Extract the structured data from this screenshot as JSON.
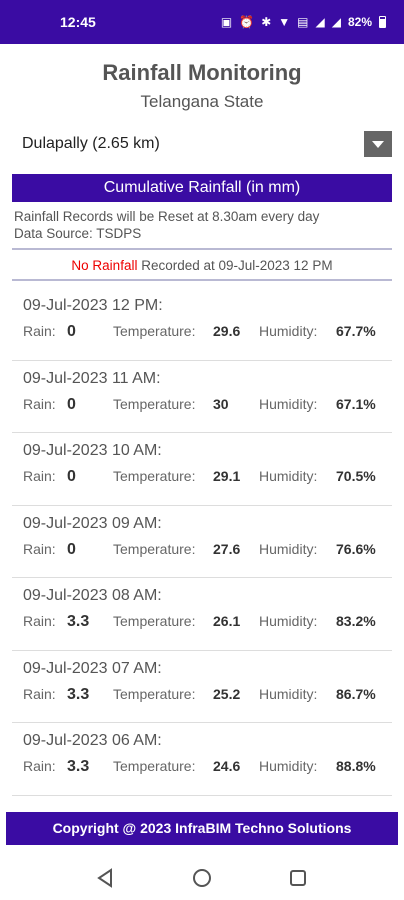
{
  "status_bar": {
    "time": "12:45",
    "battery": "82%"
  },
  "header": {
    "title": "Rainfall Monitoring",
    "subtitle": "Telangana State"
  },
  "station": {
    "selected": "Dulapally (2.65 km)"
  },
  "cumulative_label": "Cumulative Rainfall (in mm)",
  "notes": {
    "reset": "Rainfall Records will be Reset at 8.30am every day",
    "source": "Data Source: TSDPS"
  },
  "recorded": {
    "status": "No Rainfall",
    "text": " Recorded at 09-Jul-2023 12 PM"
  },
  "labels": {
    "rain": "Rain:",
    "temperature": "Temperature:",
    "humidity": "Humidity:"
  },
  "entries": [
    {
      "datetime": "09-Jul-2023 12 PM:",
      "rain": "0",
      "temperature": "29.6",
      "humidity": "67.7%"
    },
    {
      "datetime": "09-Jul-2023 11 AM:",
      "rain": "0",
      "temperature": "30",
      "humidity": "67.1%"
    },
    {
      "datetime": "09-Jul-2023 10 AM:",
      "rain": "0",
      "temperature": "29.1",
      "humidity": "70.5%"
    },
    {
      "datetime": "09-Jul-2023 09 AM:",
      "rain": "0",
      "temperature": "27.6",
      "humidity": "76.6%"
    },
    {
      "datetime": "09-Jul-2023 08 AM:",
      "rain": "3.3",
      "temperature": "26.1",
      "humidity": "83.2%"
    },
    {
      "datetime": "09-Jul-2023 07 AM:",
      "rain": "3.3",
      "temperature": "25.2",
      "humidity": "86.7%"
    },
    {
      "datetime": "09-Jul-2023 06 AM:",
      "rain": "3.3",
      "temperature": "24.6",
      "humidity": "88.8%"
    }
  ],
  "footer": "Copyright @ 2023 InfraBIM Techno Solutions",
  "colors": {
    "accent": "#3a0ca3",
    "no_rain": "#ee0000"
  }
}
